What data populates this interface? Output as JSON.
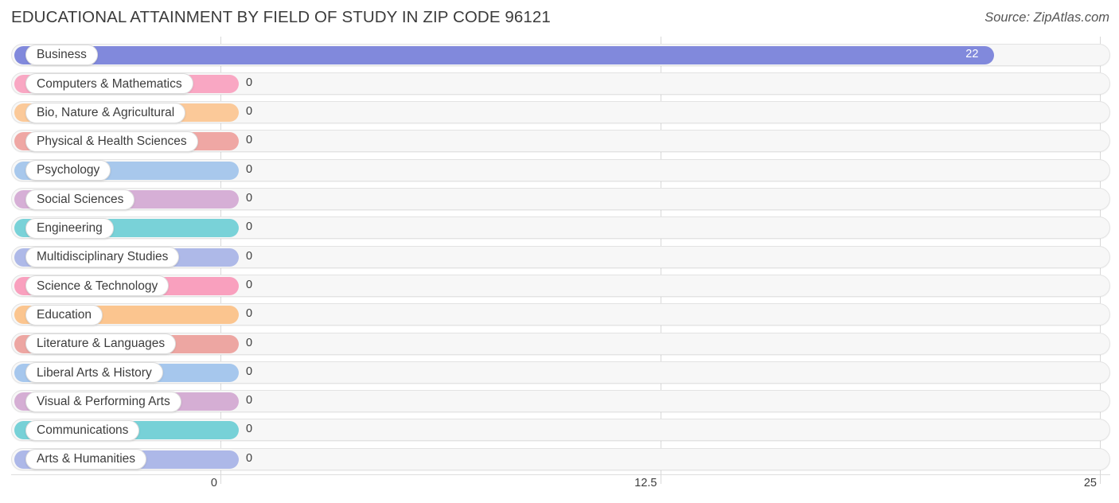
{
  "header": {
    "title": "EDUCATIONAL ATTAINMENT BY FIELD OF STUDY IN ZIP CODE 96121",
    "source": "Source: ZipAtlas.com"
  },
  "chart_data": {
    "type": "bar",
    "orientation": "horizontal",
    "title": "EDUCATIONAL ATTAINMENT BY FIELD OF STUDY IN ZIP CODE 96121",
    "subtitle": "Source: ZipAtlas.com",
    "xlabel": "",
    "ylabel": "",
    "xlim": [
      0,
      25
    ],
    "xticks": [
      0,
      12.5,
      25
    ],
    "xtick_labels": [
      "0",
      "12.5",
      "25"
    ],
    "grid": true,
    "legend": false,
    "categories": [
      "Business",
      "Computers & Mathematics",
      "Bio, Nature & Agricultural",
      "Physical & Health Sciences",
      "Psychology",
      "Social Sciences",
      "Engineering",
      "Multidisciplinary Studies",
      "Science & Technology",
      "Education",
      "Literature & Languages",
      "Liberal Arts & History",
      "Visual & Performing Arts",
      "Communications",
      "Arts & Humanities"
    ],
    "values": [
      22,
      0,
      0,
      0,
      0,
      0,
      0,
      0,
      0,
      0,
      0,
      0,
      0,
      0,
      0
    ],
    "value_labels": [
      "22",
      "0",
      "0",
      "0",
      "0",
      "0",
      "0",
      "0",
      "0",
      "0",
      "0",
      "0",
      "0",
      "0",
      "0"
    ],
    "bar_colors": [
      "#8189dc",
      "#f9a7c3",
      "#fbc999",
      "#efa7a4",
      "#a8c8ec",
      "#d6afd6",
      "#79d2d8",
      "#aeb9e8",
      "#f9a0be",
      "#fbc58f",
      "#eda6a2",
      "#a6c7ed",
      "#d5aed4",
      "#77d1d7",
      "#adb8e8"
    ]
  },
  "rows": [
    {
      "label": "Business",
      "value_label": "22",
      "value": 22,
      "color": "#8189dc",
      "value_inside": true
    },
    {
      "label": "Computers & Mathematics",
      "value_label": "0",
      "value": 0,
      "color": "#f9a7c3",
      "value_inside": false
    },
    {
      "label": "Bio, Nature & Agricultural",
      "value_label": "0",
      "value": 0,
      "color": "#fbc999",
      "value_inside": false
    },
    {
      "label": "Physical & Health Sciences",
      "value_label": "0",
      "value": 0,
      "color": "#efa7a4",
      "value_inside": false
    },
    {
      "label": "Psychology",
      "value_label": "0",
      "value": 0,
      "color": "#a8c8ec",
      "value_inside": false
    },
    {
      "label": "Social Sciences",
      "value_label": "0",
      "value": 0,
      "color": "#d6afd6",
      "value_inside": false
    },
    {
      "label": "Engineering",
      "value_label": "0",
      "value": 0,
      "color": "#79d2d8",
      "value_inside": false
    },
    {
      "label": "Multidisciplinary Studies",
      "value_label": "0",
      "value": 0,
      "color": "#aeb9e8",
      "value_inside": false
    },
    {
      "label": "Science & Technology",
      "value_label": "0",
      "value": 0,
      "color": "#f9a0be",
      "value_inside": false
    },
    {
      "label": "Education",
      "value_label": "0",
      "value": 0,
      "color": "#fbc58f",
      "value_inside": false
    },
    {
      "label": "Literature & Languages",
      "value_label": "0",
      "value": 0,
      "color": "#eda6a2",
      "value_inside": false
    },
    {
      "label": "Liberal Arts & History",
      "value_label": "0",
      "value": 0,
      "color": "#a6c7ed",
      "value_inside": false
    },
    {
      "label": "Visual & Performing Arts",
      "value_label": "0",
      "value": 0,
      "color": "#d5aed4",
      "value_inside": false
    },
    {
      "label": "Communications",
      "value_label": "0",
      "value": 0,
      "color": "#77d1d7",
      "value_inside": false
    },
    {
      "label": "Arts & Humanities",
      "value_label": "0",
      "value": 0,
      "color": "#adb8e8",
      "value_inside": false
    }
  ],
  "axis": {
    "ticks": [
      {
        "label": "0",
        "value": 0
      },
      {
        "label": "12.5",
        "value": 12.5
      },
      {
        "label": "25",
        "value": 25
      }
    ]
  }
}
